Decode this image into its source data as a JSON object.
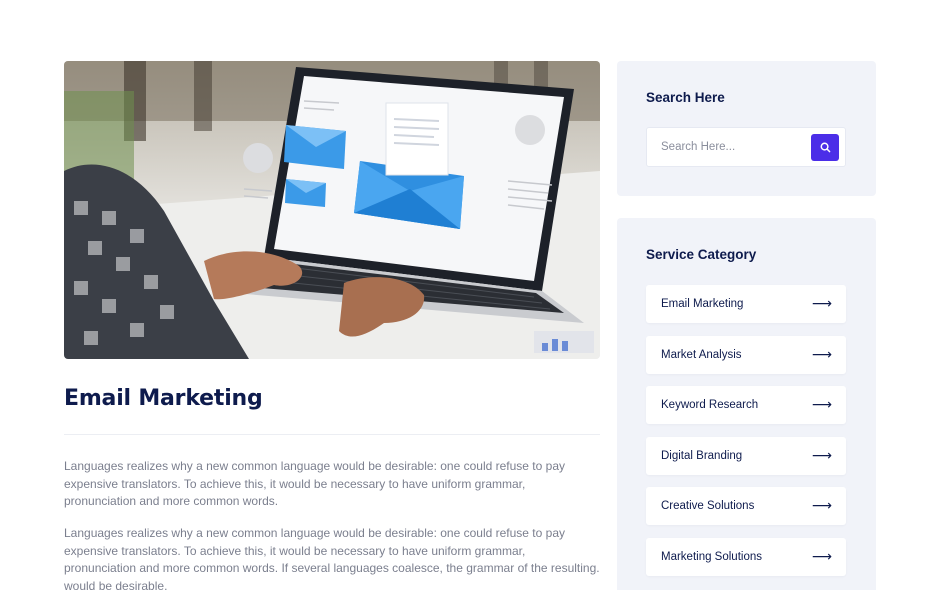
{
  "post": {
    "title": "Email Marketing",
    "paragraphs": [
      "Languages realizes why a new common language would be desirable: one could refuse to pay expensive translators. To achieve this, it would be necessary to have uniform grammar, pronunciation and more common words.",
      "Languages realizes why a new common language would be desirable: one could refuse to pay expensive translators. To achieve this, it would be necessary to have uniform grammar, pronunciation and more common words. If several languages coalesce, the grammar of the resulting. would be desirable."
    ]
  },
  "sidebar": {
    "search": {
      "title": "Search Here",
      "placeholder": "Search Here...",
      "button_icon": "search-icon"
    },
    "categories": {
      "title": "Service Category",
      "items": [
        {
          "label": "Email Marketing",
          "icon": "arrow-right-icon"
        },
        {
          "label": "Market Analysis",
          "icon": "arrow-right-icon"
        },
        {
          "label": "Keyword Research",
          "icon": "arrow-right-icon"
        },
        {
          "label": "Digital Branding",
          "icon": "arrow-right-icon"
        },
        {
          "label": "Creative Solutions",
          "icon": "arrow-right-icon"
        },
        {
          "label": "Marketing Solutions",
          "icon": "arrow-right-icon"
        }
      ]
    }
  },
  "colors": {
    "heading": "#0e1b4d",
    "body_text": "#7b7f8e",
    "accent": "#4b2ee8",
    "widget_bg": "#f1f3f9"
  }
}
